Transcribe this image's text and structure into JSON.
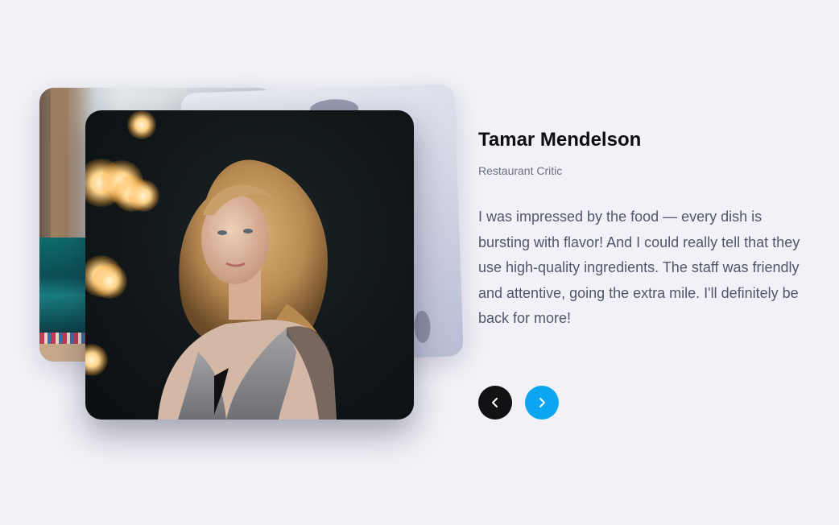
{
  "testimonial": {
    "name": "Tamar Mendelson",
    "role": "Restaurant Critic",
    "quote": "I was impressed by the food — every dish is bursting with flavor! And I could really tell that they use high-quality ingredients. The staff was friendly and attentive, going the extra mile. I'll definitely be back for more!"
  },
  "navigation": {
    "prev_icon": "chevron-left-icon",
    "next_icon": "chevron-right-icon"
  },
  "colors": {
    "background": "#f1f1f7",
    "prev_button": "#121214",
    "next_button": "#0aa6f2",
    "name_text": "#0e0e12",
    "body_text": "#52566a"
  }
}
